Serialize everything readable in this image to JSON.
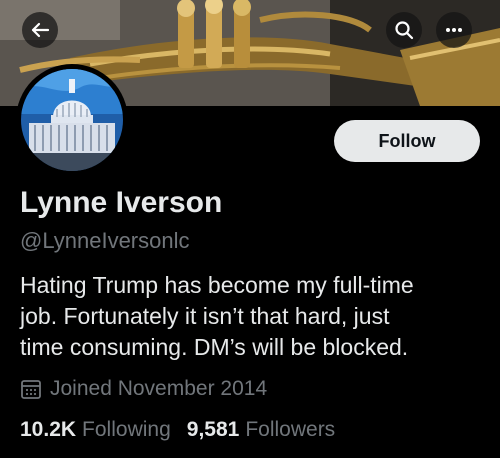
{
  "profile": {
    "display_name": "Lynne Iverson",
    "handle": "@LynneIversonlc",
    "bio_lines": [
      "Hating Trump has become my full-time",
      "job. Fortunately it isn’t that hard, just",
      "time consuming. DM’s will be blocked."
    ],
    "joined": "Joined November 2014"
  },
  "actions": {
    "follow_label": "Follow"
  },
  "stats": {
    "following_count": "10.2K",
    "following_label": "Following",
    "followers_count": "9,581",
    "followers_label": "Followers"
  },
  "icons": {
    "back": "arrow-left-icon",
    "search": "search-icon",
    "more": "more-dots-icon",
    "calendar": "calendar-icon"
  },
  "colors": {
    "background": "#000000",
    "primary_text": "#e7e9ea",
    "secondary_text": "#71767b",
    "follow_button_bg": "#e7e9ea",
    "follow_button_text": "#0f1419"
  }
}
